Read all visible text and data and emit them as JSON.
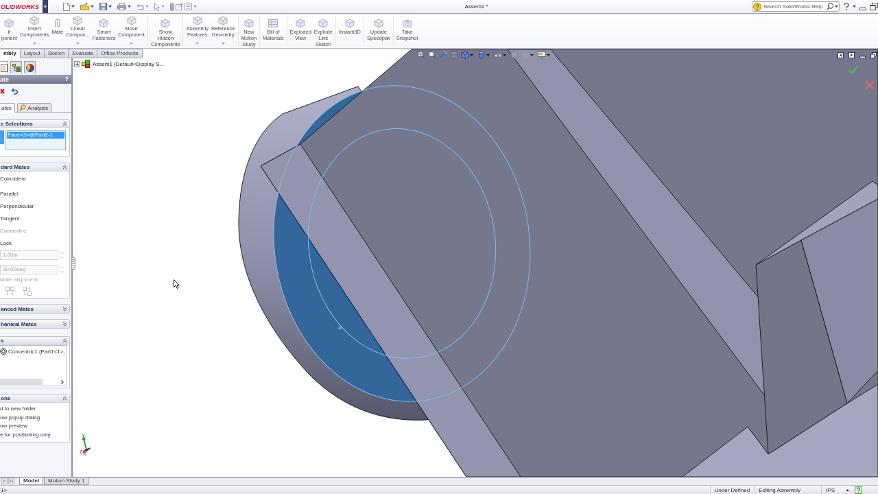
{
  "title_bar": {
    "logo": "OLIDWORKS",
    "document_title": "Assem1 *",
    "search": {
      "placeholder": "Search SolidWorks Help"
    }
  },
  "command_manager": {
    "groups": [
      [
        {
          "label": "it\nponent",
          "dropdown": false
        },
        {
          "label": "Insert\nComponents",
          "dropdown": true
        },
        {
          "label": "Mate",
          "dropdown": false
        },
        {
          "label": "Linear\nCompon...",
          "dropdown": true
        },
        {
          "label": "Smart\nFasteners",
          "dropdown": false
        },
        {
          "label": "Move\nComponent",
          "dropdown": true
        }
      ],
      [
        {
          "label": "Show\nHidden\nComponents",
          "dropdown": false
        }
      ],
      [
        {
          "label": "Assembly\nFeatures",
          "dropdown": true
        },
        {
          "label": "Reference\nGeometry",
          "dropdown": true
        }
      ],
      [
        {
          "label": "New\nMotion\nStudy",
          "dropdown": false
        }
      ],
      [
        {
          "label": "Bill of\nMaterials",
          "dropdown": false
        }
      ],
      [
        {
          "label": "Exploded\nView",
          "dropdown": false
        },
        {
          "label": "Explode\nLine\nSketch",
          "dropdown": false
        }
      ],
      [
        {
          "label": "Instant3D",
          "dropdown": false
        }
      ],
      [
        {
          "label": "Update\nSpeedpak",
          "dropdown": false
        }
      ],
      [
        {
          "label": "Take\nSnapshot",
          "dropdown": false
        }
      ]
    ],
    "tabs": [
      {
        "label": "mbly",
        "selected": true
      },
      {
        "label": "Layout",
        "selected": false
      },
      {
        "label": "Sketch",
        "selected": false
      },
      {
        "label": "Evaluate",
        "selected": false
      },
      {
        "label": "Office Products",
        "selected": false
      }
    ]
  },
  "property_manager": {
    "tabs": [
      {
        "selected": true
      },
      {
        "selected": false
      },
      {
        "selected": false
      }
    ],
    "title": "ate",
    "help": "?",
    "mode_tabs": [
      {
        "kind": "text",
        "label": "ates",
        "selected": true
      },
      {
        "kind": "icon_text",
        "label": "Analysis",
        "selected": false
      }
    ],
    "sections": [
      {
        "kind": "selection_list",
        "title": "e Selections",
        "expanded": true,
        "items": [
          {
            "label": "Face<3>@Part2-1",
            "selected": true
          }
        ]
      },
      {
        "kind": "mate_types",
        "title": "dard Mates",
        "expanded": true,
        "items": [
          {
            "label": "Coincident",
            "disabled": false
          },
          {
            "label": "Parallel",
            "disabled": false
          },
          {
            "label": "Perpendicular",
            "disabled": false
          },
          {
            "label": "Tangent",
            "disabled": false
          },
          {
            "label": "Concentric",
            "disabled": true
          },
          {
            "label": "Lock",
            "disabled": false
          }
        ],
        "fields": [
          {
            "value": "1.00in",
            "disabled": true
          },
          {
            "value": "30.00deg",
            "disabled": true
          }
        ],
        "alignment": {
          "label": "Mate alignment:",
          "disabled": true
        }
      },
      {
        "kind": "plain",
        "title": "anced Mates",
        "expanded": false
      },
      {
        "kind": "plain",
        "title": "hanical Mates",
        "expanded": false
      },
      {
        "kind": "mate_list",
        "title": "s",
        "expanded": true,
        "items": [
          {
            "label": "Concentric1 (Part1<1>,"
          }
        ]
      },
      {
        "kind": "options",
        "title": "ons",
        "expanded": true,
        "items": [
          {
            "label": "d to new folder"
          },
          {
            "label": "ow popup dialog"
          },
          {
            "label": "ow preview"
          },
          {
            "label": "e for positioning only"
          }
        ]
      }
    ]
  },
  "viewport": {
    "feature_tree": {
      "label": "Assem1 (Default<Display S...",
      "expanded": false
    },
    "triad": {
      "labels": [
        "Y",
        "Z",
        "X"
      ]
    }
  },
  "sheet_tabs": [
    {
      "label": "Model",
      "selected": true
    },
    {
      "label": "Motion Study 1",
      "selected": false
    }
  ],
  "status_bar": {
    "prompt": "1>",
    "items": [
      "Under Defined",
      "Editing Assembly",
      "IPS"
    ]
  }
}
